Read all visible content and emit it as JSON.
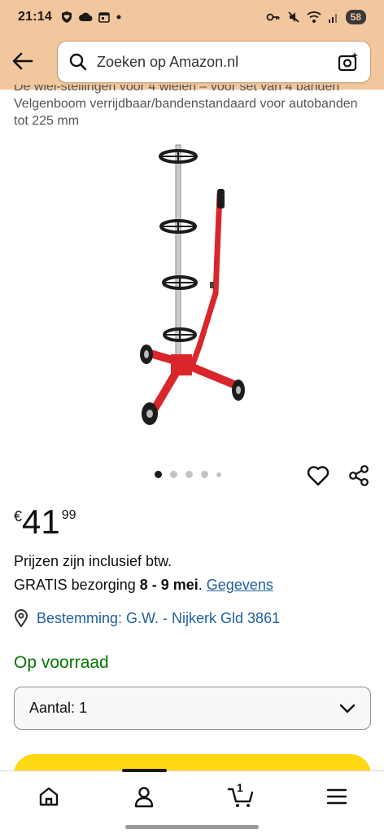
{
  "status": {
    "time": "21:14",
    "battery": "58"
  },
  "search": {
    "placeholder": "Zoeken op Amazon.nl"
  },
  "product": {
    "title_cut": "De wiel-stellingen voor 4 wielen – voor set van 4 banden",
    "title": "Velgenboom verrijdbaar/bandenstandaard voor autobanden tot 225 mm",
    "price": {
      "symbol": "€",
      "whole": "41",
      "fraction": "99"
    },
    "vat_note": "Prijzen zijn inclusief btw.",
    "delivery_prefix": "GRATIS bezorging ",
    "delivery_date": "8 - 9 mei",
    "delivery_suffix": ". ",
    "details_link": "Gegevens",
    "location": "Bestemming: G.W. - Nijkerk Gld 3861",
    "stock": "Op voorraad",
    "quantity_label": "Aantal:",
    "quantity_value": "1"
  },
  "carousel": {
    "count": 5,
    "active_index": 0
  },
  "nav": {
    "cart_count": "1"
  },
  "colors": {
    "header_bg": "#f3c79d",
    "link": "#2162a1",
    "stock": "#007600",
    "cart_button": "#ffd814",
    "stand_red": "#d8262b"
  },
  "icons": [
    "back-arrow-icon",
    "search-icon",
    "camera-search-icon",
    "heart-icon",
    "share-icon",
    "location-pin-icon",
    "chevron-down-icon",
    "home-icon",
    "user-icon",
    "cart-icon",
    "menu-icon"
  ]
}
